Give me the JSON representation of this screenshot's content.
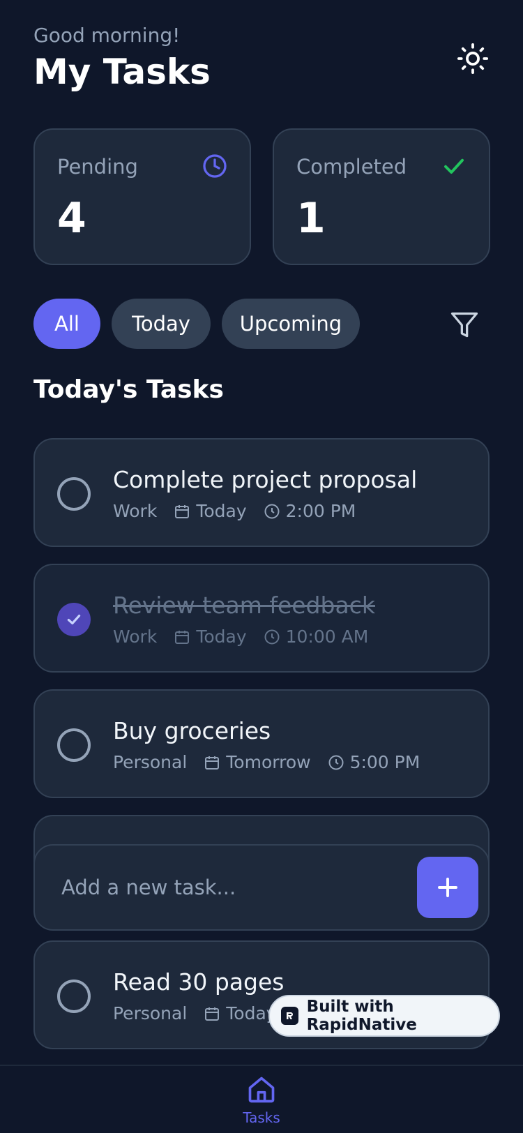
{
  "header": {
    "greeting": "Good morning!",
    "title": "My Tasks",
    "theme_icon": "sun-icon"
  },
  "stats": {
    "pending": {
      "label": "Pending",
      "value": "4",
      "icon": "clock-icon",
      "color": "#6366f1"
    },
    "completed": {
      "label": "Completed",
      "value": "1",
      "icon": "check-icon",
      "color": "#22c55e"
    }
  },
  "filters": {
    "chips": [
      "All",
      "Today",
      "Upcoming"
    ],
    "active": "All",
    "filter_icon": "funnel-icon"
  },
  "section_title": "Today's Tasks",
  "tasks": [
    {
      "title": "Complete project proposal",
      "category": "Work",
      "date": "Today",
      "time": "2:00 PM",
      "completed": false
    },
    {
      "title": "Review team feedback",
      "category": "Work",
      "date": "Today",
      "time": "10:00 AM",
      "completed": true
    },
    {
      "title": "Buy groceries",
      "category": "Personal",
      "date": "Tomorrow",
      "time": "5:00 PM",
      "completed": false
    },
    {
      "title": "Read 30 pages",
      "category": "Personal",
      "date": "Today",
      "time": "",
      "completed": false
    }
  ],
  "add_task": {
    "placeholder": "Add a new task...",
    "button_icon": "plus-icon"
  },
  "badge": {
    "text": "Built with RapidNative"
  },
  "nav": {
    "tasks_label": "Tasks",
    "icon": "home-icon"
  },
  "colors": {
    "background": "#0f172a",
    "card": "#1e293b",
    "accent": "#6366f1",
    "success": "#22c55e"
  }
}
